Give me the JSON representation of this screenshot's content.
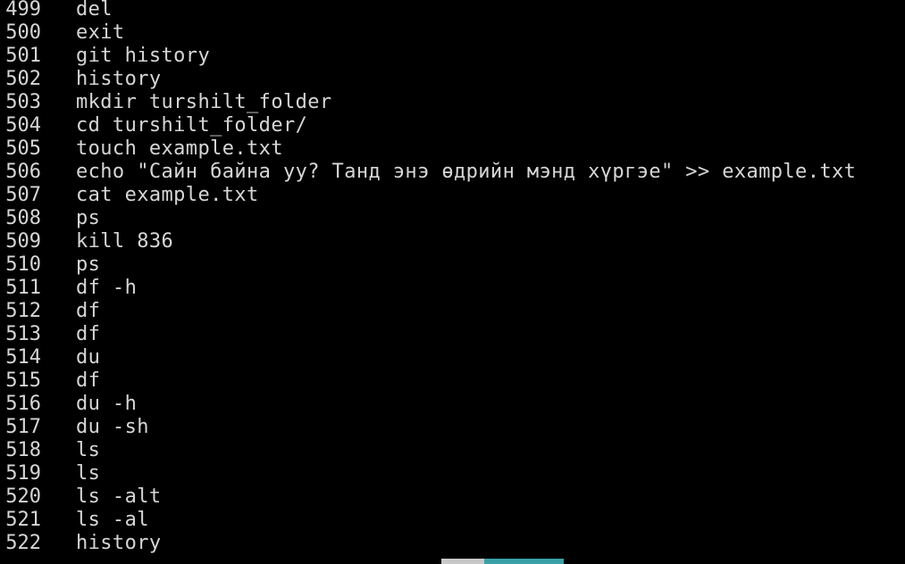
{
  "history": [
    {
      "num": "499",
      "cmd": "del"
    },
    {
      "num": "500",
      "cmd": "exit"
    },
    {
      "num": "501",
      "cmd": "git history"
    },
    {
      "num": "502",
      "cmd": "history"
    },
    {
      "num": "503",
      "cmd": "mkdir turshilt_folder"
    },
    {
      "num": "504",
      "cmd": "cd turshilt_folder/"
    },
    {
      "num": "505",
      "cmd": "touch example.txt"
    },
    {
      "num": "506",
      "cmd": "echo \"Сайн байна уу? Танд энэ өдрийн мэнд хүргэе\" >> example.txt"
    },
    {
      "num": "507",
      "cmd": "cat example.txt"
    },
    {
      "num": "508",
      "cmd": "ps"
    },
    {
      "num": "509",
      "cmd": "kill 836"
    },
    {
      "num": "510",
      "cmd": "ps"
    },
    {
      "num": "511",
      "cmd": "df -h"
    },
    {
      "num": "512",
      "cmd": "df"
    },
    {
      "num": "513",
      "cmd": "df"
    },
    {
      "num": "514",
      "cmd": "du"
    },
    {
      "num": "515",
      "cmd": "df"
    },
    {
      "num": "516",
      "cmd": "du -h"
    },
    {
      "num": "517",
      "cmd": "du -sh"
    },
    {
      "num": "518",
      "cmd": "ls"
    },
    {
      "num": "519",
      "cmd": "ls"
    },
    {
      "num": "520",
      "cmd": "ls -alt"
    },
    {
      "num": "521",
      "cmd": "ls -al"
    },
    {
      "num": "522",
      "cmd": "history"
    }
  ],
  "colors": {
    "background": "#000000",
    "text": "#d6d6d6",
    "status_segment_a": "#c8c8c8",
    "status_segment_b": "#3aa0a8"
  }
}
